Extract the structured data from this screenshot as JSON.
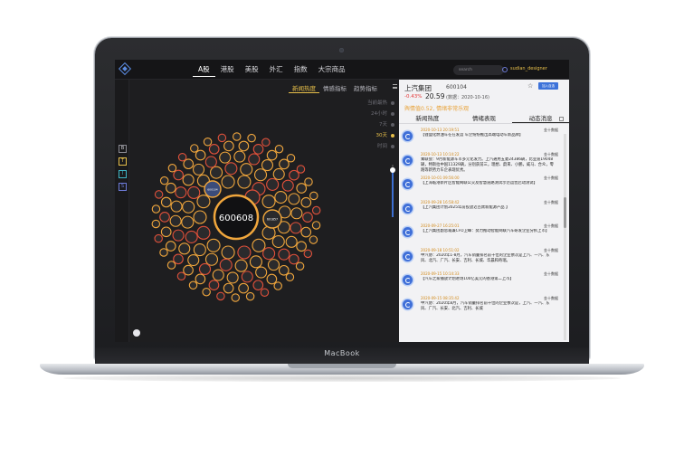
{
  "device": {
    "brand": "MacBook"
  },
  "topbar": {
    "markets": [
      "A股",
      "港股",
      "美股",
      "外汇",
      "指数",
      "大宗商品"
    ],
    "active_market": 0,
    "search_placeholder": "search",
    "user": "sudian_designer"
  },
  "rail": {
    "buttons": [
      "B",
      "T",
      "I",
      "S"
    ]
  },
  "viz": {
    "tabs": [
      "新闻热度",
      "情感指标",
      "趋势指标"
    ],
    "active_tab": 0,
    "time_ranges": [
      "当前最热",
      "24小时",
      "7天",
      "30天",
      "时间"
    ],
    "active_time": 3,
    "center_label": "600608",
    "secondary_labels": [
      "600104",
      "601857"
    ]
  },
  "panel": {
    "stock_name": "上汽集团",
    "stock_code": "600104",
    "change": "-0.43%",
    "price": "20.59",
    "price_date": "(数据：2020-10-16)",
    "add_label": "加入自选",
    "sentiment": "舆情值0.52, 情绪非常乐观",
    "tabs": [
      "新闻热度",
      "情绪表现",
      "动态消息"
    ],
    "active_tab": 2
  },
  "feed": [
    {
      "time": "2020-10-13 20:19:51",
      "source": "金十数据",
      "text": "【锂盛化燃油车在在发运 车企纷纷推出高端电动车新品牌】"
    },
    {
      "time": "2020-10-13 10:14:22",
      "source": "金十数据",
      "text": "乘联会：9月新能源车市多元化发力。上汽通用五菱24386辆，比亚迪19048辆，特斯拉中国11329辆，分别获前三，理想、蔚来、小鹏，威马、合众，零跑等新势力车企表现优秀。"
    },
    {
      "time": "2020-10-01 09:56:00",
      "source": "金十数据",
      "text": "【上海临港新片区智能网联公交及智慧道路测试示范运营启动测试】"
    },
    {
      "time": "2020-09-28 16:58:42",
      "source": "金十数据",
      "text": "【上汽集团计划2025年前投放近百款新能源产品 】"
    },
    {
      "time": "2020-09-27 16:25:01",
      "source": "金十数据",
      "text": "【上汽集团副总裁兼CFO卫峰：努力推动智能网联汽车研发企业分拆上市】"
    },
    {
      "time": "2020-09-18 10:51:02",
      "source": "金十数据",
      "text": "中汽协：2020年1-8月，汽车销量排名前十位的企业依次是上汽、一汽、东风、北汽、广汽、长安、吉利、长城、华晨和奇瑞。"
    },
    {
      "time": "2020-09-15 10:14:33",
      "source": "金十数据",
      "text": "【汽车之家播放计划进场100亿美元的香港第二上市】"
    },
    {
      "time": "2020-09-15 08:35:42",
      "source": "金十数据",
      "text": "中汽协：2020年8月，汽车销量排名前十位的企业依次是，上汽、一汽、东风、广汽、长安、北汽、吉利、长城"
    }
  ],
  "colors": {
    "accent": "#e8c04a",
    "ring_outer": "#f0a63c",
    "ring_inner": "#e0503a",
    "link": "#3d72d9"
  }
}
